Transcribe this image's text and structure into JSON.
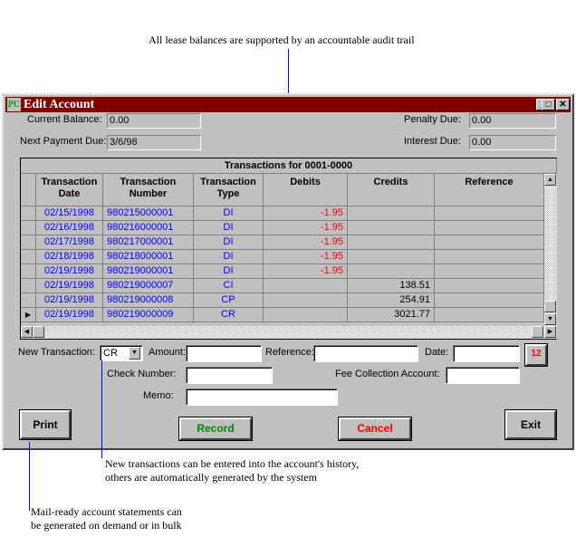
{
  "annotations": {
    "top": "All lease balances are supported by an accountable audit trail",
    "middle": [
      "New transactions can be entered into the account's history,",
      "others are automatically generated by the system"
    ],
    "bottom": [
      "Mail-ready account statements can",
      "be generated on demand or in bulk"
    ]
  },
  "window": {
    "title": "Edit Account",
    "icon": "app-logo-icon",
    "title_color": "#800000",
    "controls": [
      "minimize",
      "maximize",
      "close"
    ]
  },
  "summary": {
    "current_balance_label": "Current Balance:",
    "current_balance": "0.00",
    "next_payment_label": "Next Payment Due:",
    "next_payment": "3/6/98",
    "penalty_label": "Penalty Due:",
    "penalty": "0.00",
    "interest_label": "Interest Due:",
    "interest": "0.00"
  },
  "grid": {
    "title": "Transactions for 0001-0000",
    "columns": [
      [
        "Transaction",
        "Date"
      ],
      [
        "Transaction",
        "Number"
      ],
      [
        "Transaction",
        "Type"
      ],
      [
        "Debits",
        ""
      ],
      [
        "Credits",
        ""
      ],
      [
        "Reference",
        ""
      ]
    ],
    "rows": [
      [
        "02/15/1998",
        "980215000001",
        "DI",
        "-1.95",
        "",
        ""
      ],
      [
        "02/16/1998",
        "980216000001",
        "DI",
        "-1.95",
        "",
        ""
      ],
      [
        "02/17/1998",
        "980217000001",
        "DI",
        "-1.95",
        "",
        ""
      ],
      [
        "02/18/1998",
        "980218000001",
        "DI",
        "-1.95",
        "",
        ""
      ],
      [
        "02/19/1998",
        "980219000001",
        "DI",
        "-1.95",
        "",
        ""
      ],
      [
        "02/19/1998",
        "980219000007",
        "CI",
        "",
        "138.51",
        ""
      ],
      [
        "02/19/1998",
        "980219000008",
        "CP",
        "",
        "254.91",
        ""
      ],
      [
        "02/19/1998",
        "980219000009",
        "CR",
        "",
        "3021.77",
        ""
      ]
    ],
    "current_row": 7
  },
  "form": {
    "new_transaction_label": "New Transaction:",
    "new_transaction": "CR",
    "amount_label": "Amount:",
    "amount": "",
    "reference_label": "Reference:",
    "reference": "",
    "date_label": "Date:",
    "date": "",
    "check_label": "Check Number:",
    "check": "",
    "fee_label": "Fee Collection Account:",
    "fee": "",
    "memo_label": "Memo:",
    "memo": ""
  },
  "buttons": {
    "print": "Print",
    "record": "Record",
    "cancel": "Cancel",
    "exit": "Exit"
  }
}
